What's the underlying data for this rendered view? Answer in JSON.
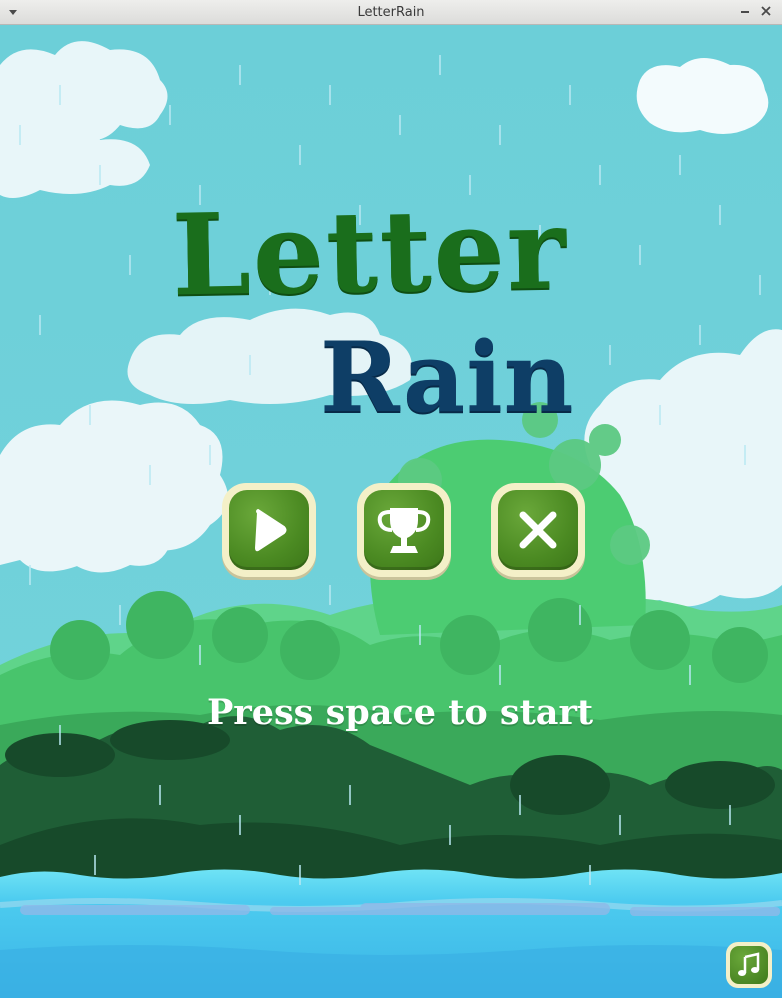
{
  "window": {
    "title": "LetterRain"
  },
  "game": {
    "title_line1": "Letter",
    "title_line2": "Rain",
    "prompt": "Press space to start",
    "buttons": {
      "play_icon": "play-icon",
      "leaderboard_icon": "trophy-icon",
      "exit_icon": "close-icon",
      "music_icon": "music-note-icon"
    }
  },
  "colors": {
    "sky": "#6dd0da",
    "title_green": "#1a6e1c",
    "title_navy": "#0e3e66",
    "button_frame": "#f4f0c8",
    "button_green": "#4b8a22",
    "water": "#41c3ea"
  }
}
